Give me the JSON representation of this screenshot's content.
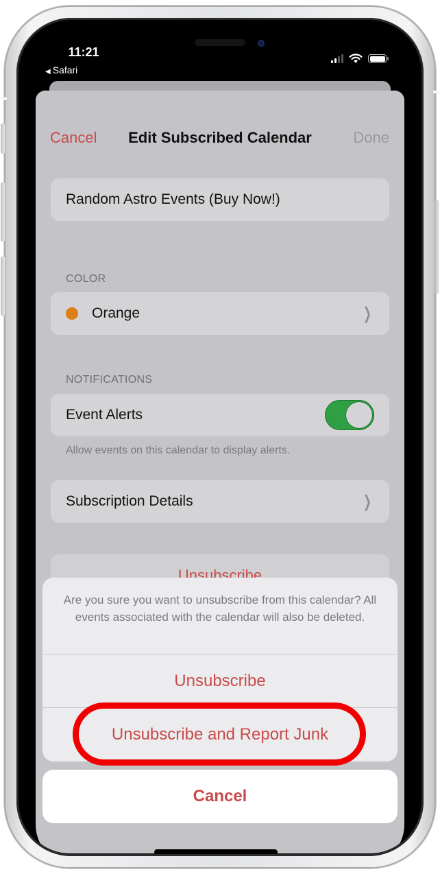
{
  "status_bar": {
    "time": "11:21",
    "back_app": "Safari",
    "back_icon": "back-triangle-icon",
    "signal_bars_active": 2,
    "signal_bars_total": 4,
    "wifi": "wifi-icon",
    "battery": "battery-icon"
  },
  "nav": {
    "cancel_label": "Cancel",
    "title": "Edit Subscribed Calendar",
    "done_label": "Done"
  },
  "calendar": {
    "name": "Random Astro Events (Buy Now!)"
  },
  "color_section": {
    "header": "COLOR",
    "value": "Orange",
    "swatch": "#db7f16"
  },
  "notifications_section": {
    "header": "NOTIFICATIONS",
    "toggle_label": "Event Alerts",
    "toggle_on": true,
    "footer": "Allow events on this calendar to display alerts."
  },
  "subscription_details": {
    "label": "Subscription Details"
  },
  "unsubscribe_row": {
    "label": "Unsubscribe"
  },
  "action_sheet": {
    "message": "Are you sure you want to unsubscribe from this calendar? All events associated with the calendar will also be deleted.",
    "actions": [
      {
        "label": "Unsubscribe"
      },
      {
        "label": "Unsubscribe and Report Junk",
        "highlighted": true
      }
    ],
    "cancel_label": "Cancel"
  },
  "colors": {
    "destructive": "#c84a4a",
    "toggle_on": "#2ea043",
    "highlight": "#f00000"
  }
}
